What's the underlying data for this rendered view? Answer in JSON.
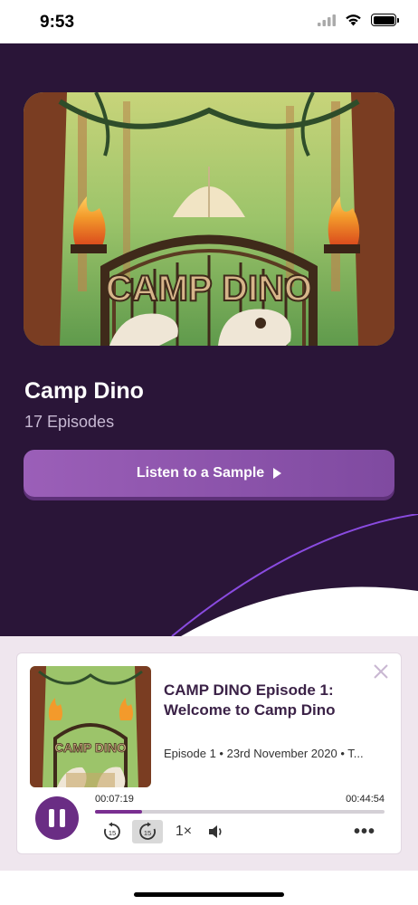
{
  "status_bar": {
    "time": "9:53"
  },
  "podcast": {
    "cover_text": "CAMP DINO",
    "title": "Camp Dino",
    "episode_count": "17 Episodes",
    "sample_button_label": "Listen to a Sample"
  },
  "player": {
    "episode_title": "CAMP DINO Episode 1: Welcome to Camp Dino",
    "episode_meta": "Episode 1 • 23rd November 2020 • T...",
    "elapsed": "00:07:19",
    "duration": "00:44:54",
    "progress_fraction": 0.163,
    "speed": "1×",
    "skip_back_seconds": "15",
    "skip_forward_seconds": "15",
    "more_label": "•••"
  },
  "colors": {
    "hero_background": "#2a1538",
    "accent_purple": "#6a2d84",
    "button_purple": "#9b5fb8",
    "title_text": "#3b2247"
  },
  "icons": [
    "wifi-icon",
    "signal-icon",
    "battery-icon",
    "play-icon",
    "close-icon",
    "pause-icon",
    "rewind-15-icon",
    "forward-15-icon",
    "volume-icon",
    "more-icon"
  ]
}
